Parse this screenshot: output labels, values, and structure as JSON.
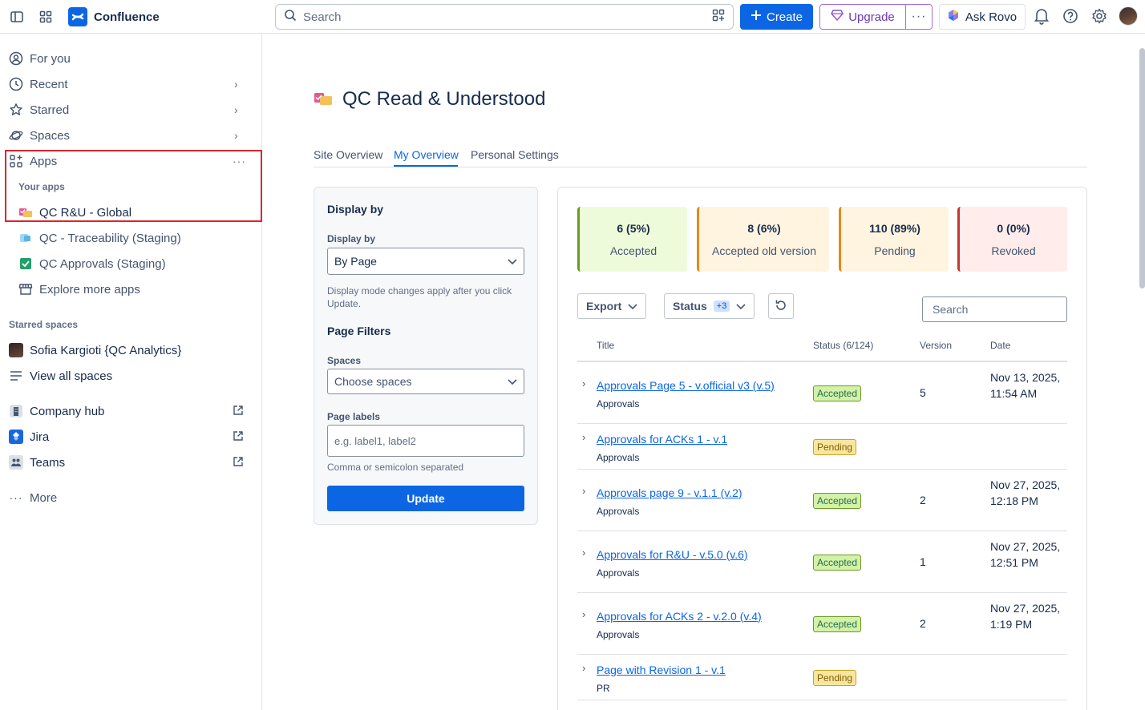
{
  "topbar": {
    "app_name": "Confluence",
    "search_placeholder": "Search",
    "create_label": "Create",
    "upgrade_label": "Upgrade",
    "rovo_label": "Ask Rovo"
  },
  "sidebar": {
    "items": [
      {
        "label": "For you"
      },
      {
        "label": "Recent"
      },
      {
        "label": "Starred"
      },
      {
        "label": "Spaces"
      },
      {
        "label": "Apps"
      }
    ],
    "your_apps_label": "Your apps",
    "apps": [
      {
        "label": "QC R&U - Global"
      },
      {
        "label": "QC - Traceability (Staging)"
      },
      {
        "label": "QC Approvals (Staging)"
      },
      {
        "label": "Explore more apps"
      }
    ],
    "starred_spaces_label": "Starred spaces",
    "starred_spaces": [
      {
        "label": "Sofia Kargioti {QC Analytics}"
      },
      {
        "label": "View all spaces"
      }
    ],
    "external": [
      {
        "label": "Company hub"
      },
      {
        "label": "Jira"
      },
      {
        "label": "Teams"
      }
    ],
    "more_label": "More"
  },
  "main": {
    "title": "QC Read & Understood",
    "tabs": [
      {
        "label": "Site Overview"
      },
      {
        "label": "My Overview"
      },
      {
        "label": "Personal Settings"
      }
    ],
    "active_tab": "My Overview"
  },
  "filters": {
    "heading": "Display by",
    "display_by_label": "Display by",
    "display_by_value": "By Page",
    "display_help": "Display mode changes apply after you click Update.",
    "page_filters_heading": "Page Filters",
    "spaces_label": "Spaces",
    "spaces_placeholder": "Choose spaces",
    "labels_label": "Page labels",
    "labels_placeholder": "e.g. label1, label2",
    "labels_help": "Comma or semicolon separated",
    "update_label": "Update"
  },
  "stats": [
    {
      "value": "6 (5%)",
      "caption": "Accepted",
      "bg": "#eefbda",
      "border": "#6a9a23"
    },
    {
      "value": "8 (6%)",
      "caption": "Accepted old version",
      "bg": "#fff4e0",
      "border": "#e2891e"
    },
    {
      "value": "110 (89%)",
      "caption": "Pending",
      "bg": "#fff4e0",
      "border": "#e2891e"
    },
    {
      "value": "0 (0%)",
      "caption": "Revoked",
      "bg": "#ffeceb",
      "border": "#c9372c"
    }
  ],
  "toolbar": {
    "export_label": "Export",
    "status_label": "Status",
    "status_count": "+3",
    "search_placeholder": "Search"
  },
  "table": {
    "headers": [
      "Title",
      "Status (6/124)",
      "Version",
      "Date"
    ],
    "rows": [
      {
        "title": "Approvals Page 5 - v.official v3 (v.5)",
        "space": "Approvals",
        "status": "Accepted",
        "version": "5",
        "date": "Nov 13, 2025, 11:54 AM"
      },
      {
        "title": "Approvals for ACKs 1 - v.1",
        "space": "Approvals",
        "status": "Pending",
        "version": "",
        "date": ""
      },
      {
        "title": "Approvals page 9 - v.1.1 (v.2)",
        "space": "Approvals",
        "status": "Accepted",
        "version": "2",
        "date": "Nov 27, 2025, 12:18 PM"
      },
      {
        "title": "Approvals for R&U - v.5.0 (v.6)",
        "space": "Approvals",
        "status": "Accepted",
        "version": "1",
        "date": "Nov 27, 2025, 12:51 PM"
      },
      {
        "title": "Approvals for ACKs 2 - v.2.0 (v.4)",
        "space": "Approvals",
        "status": "Accepted",
        "version": "2",
        "date": "Nov 27, 2025, 1:19 PM"
      },
      {
        "title": "Page with Revision 1 - v.1",
        "space": "PR",
        "status": "Pending",
        "version": "",
        "date": ""
      }
    ]
  }
}
